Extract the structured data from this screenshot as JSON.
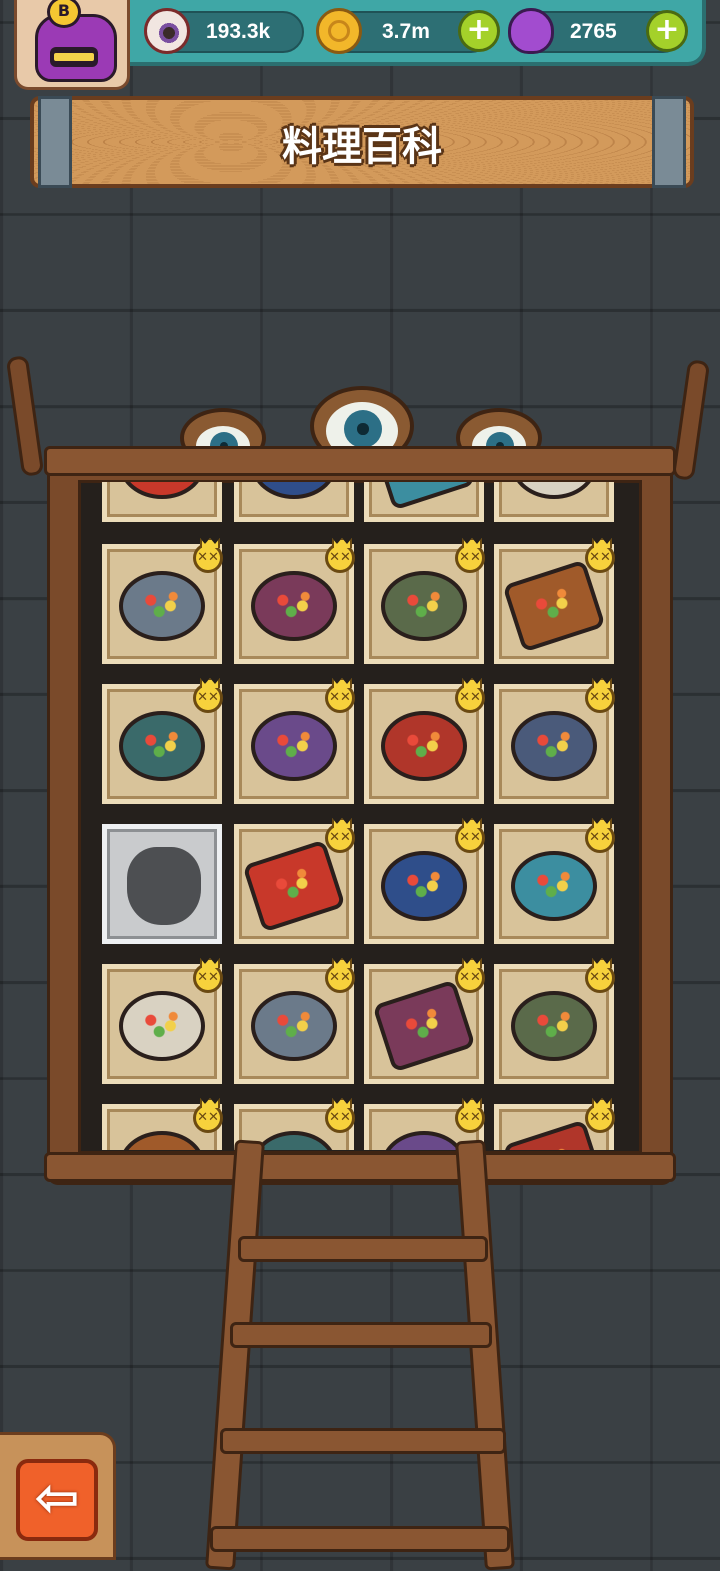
{
  "header": {
    "rank_badge": "B",
    "resources": [
      {
        "icon": "eyeball-icon",
        "value": "193.3k",
        "has_add": false
      },
      {
        "icon": "gold-coin-icon",
        "value": "3.7m",
        "has_add": true
      },
      {
        "icon": "potion-icon",
        "value": "2765",
        "has_add": true
      }
    ]
  },
  "title": "料理百科",
  "recipe_grid": {
    "rows": [
      [
        {
          "state": "unlocked",
          "crown": true
        },
        {
          "state": "unlocked",
          "crown": true
        },
        {
          "state": "unlocked",
          "crown": true
        },
        {
          "state": "unlocked",
          "crown": true
        }
      ],
      [
        {
          "state": "unlocked",
          "crown": true
        },
        {
          "state": "unlocked",
          "crown": true
        },
        {
          "state": "unlocked",
          "crown": true
        },
        {
          "state": "unlocked",
          "crown": true
        }
      ],
      [
        {
          "state": "locked",
          "crown": false
        },
        {
          "state": "unlocked",
          "crown": true
        },
        {
          "state": "unlocked",
          "crown": true
        },
        {
          "state": "unlocked",
          "crown": true
        }
      ],
      [
        {
          "state": "unlocked",
          "crown": true
        },
        {
          "state": "unlocked",
          "crown": true
        },
        {
          "state": "unlocked",
          "crown": true
        },
        {
          "state": "unlocked",
          "crown": true
        }
      ],
      [
        {
          "state": "unlocked",
          "crown": true
        },
        {
          "state": "unlocked",
          "crown": true
        },
        {
          "state": "unlocked",
          "crown": true
        },
        {
          "state": "unlocked",
          "crown": true
        }
      ]
    ]
  },
  "colors": {
    "tile_bg": "#d8c39a",
    "locked_bg": "#c9cbcd",
    "wood": "#7a4a2a",
    "accent_orange": "#f0612a",
    "teal_bar": "#3fa7a6"
  },
  "back_button": {
    "icon": "back-arrow-icon",
    "glyph": "⇦"
  }
}
